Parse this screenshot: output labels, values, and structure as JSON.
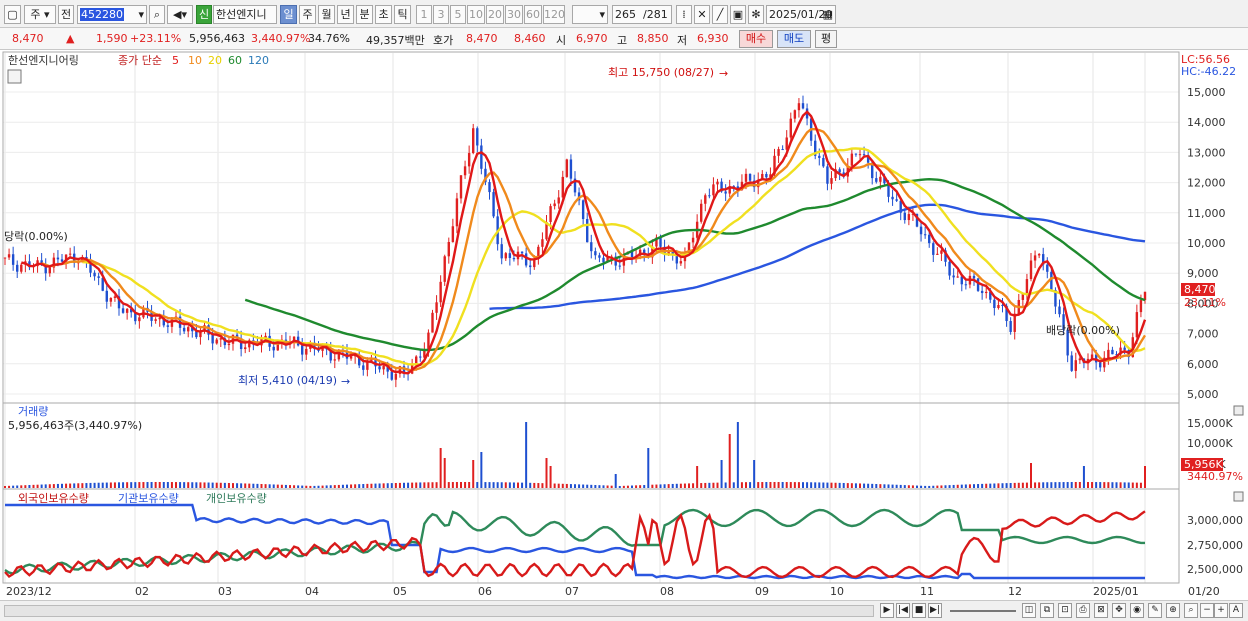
{
  "toolbar": {
    "period_short": "주",
    "prev_label": "전",
    "code": "452280",
    "sin_badge": "신",
    "stock_name": "한선엔지니",
    "period_tabs": [
      "일",
      "주",
      "월",
      "년",
      "분",
      "초",
      "틱"
    ],
    "active_tab": "일",
    "minute_opts": [
      "1",
      "3",
      "5",
      "10",
      "20",
      "30",
      "60",
      "120"
    ],
    "count": "265",
    "total": "/281",
    "date": "2025/01/20"
  },
  "infobar": {
    "price": "8,470",
    "change": "1,590",
    "change_pct": "+23.11%",
    "volume": "5,956,463",
    "vol_pct": "3,440.97%",
    "turnover": "34.76%",
    "amount": "49,357백만",
    "hoga_label": "호가",
    "ask": "8,470",
    "bid": "8,460",
    "open_label": "시",
    "open": "6,970",
    "high_label": "고",
    "high": "8,850",
    "low_label": "저",
    "low": "6,930",
    "buy_label": "매수",
    "sell_label": "매도",
    "eval_label": "평"
  },
  "price_panel": {
    "legend_name": "한선엔지니어링",
    "legend_ma": "종가 단순",
    "ma_periods": [
      "5",
      "10",
      "20",
      "60",
      "120"
    ],
    "lc": "LC:56.56",
    "hc": "HC:-46.22",
    "high_annot": "최고 15,750 (08/27)",
    "low_annot": "최저 5,410 (04/19)",
    "ex_div_left": "당락(0.00%)",
    "ex_div_right": "배당락(0.00%)",
    "last_price_tag": "8,470",
    "last_pct_tag": "23.11%",
    "y_ticks": [
      "15,000",
      "14,000",
      "13,000",
      "12,000",
      "11,000",
      "10,000",
      "9,000",
      "8,000",
      "7,000",
      "6,000",
      "5,000"
    ]
  },
  "volume_panel": {
    "title": "거래량",
    "value_text": "5,956,463주(3,440.97%)",
    "y_ticks": [
      "15,000K",
      "10,000K",
      "5,000K"
    ],
    "tag_value": "5,956K",
    "tag_pct": "3440.97%"
  },
  "holdings_panel": {
    "series": [
      "외국인보유수량",
      "기관보유수량",
      "개인보유수량"
    ],
    "y_ticks": [
      "3,000,000",
      "2,750,000",
      "2,500,000"
    ]
  },
  "x_axis": {
    "labels": [
      "2023/12",
      "02",
      "03",
      "04",
      "05",
      "06",
      "07",
      "08",
      "09",
      "10",
      "11",
      "12",
      "2025/01",
      "01/20"
    ]
  },
  "colors": {
    "up": "#e02020",
    "down": "#1e4fd0",
    "ma5": "#e01818",
    "ma10": "#f08a1c",
    "ma20": "#f0e020",
    "ma60": "#1f8a2e",
    "ma120": "#2a56e0",
    "foreign": "#d81a1a",
    "institution": "#2a56e0",
    "individual": "#2e8a5a"
  }
}
